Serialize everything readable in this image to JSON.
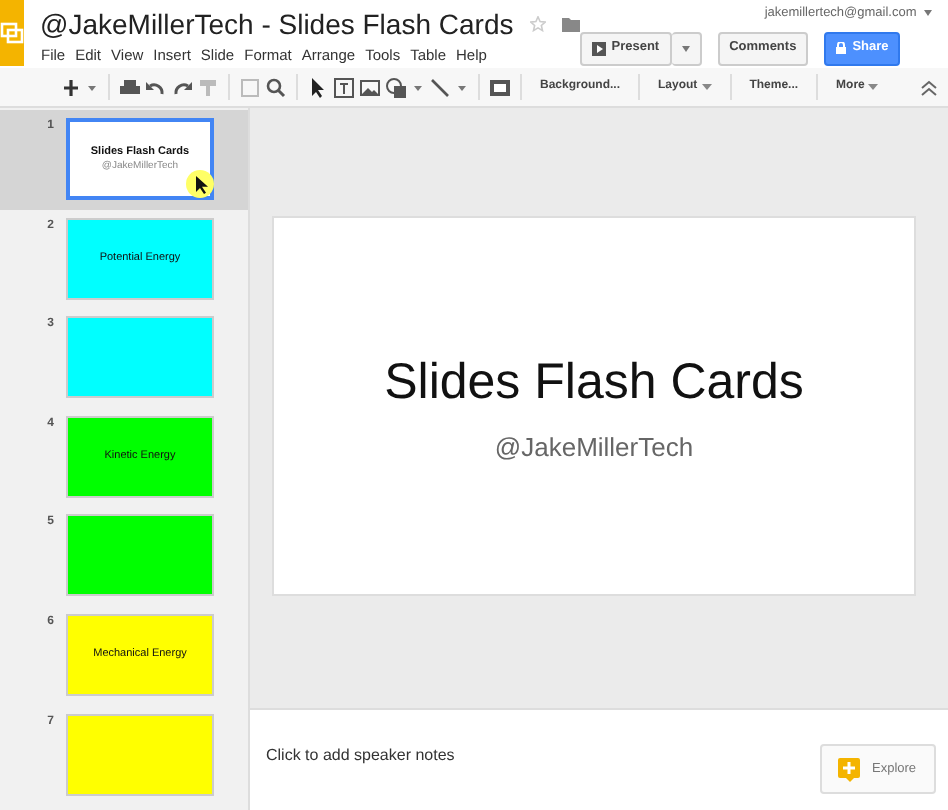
{
  "document": {
    "title": "@JakeMillerTech - Slides Flash Cards",
    "account": "jakemillertech@gmail.com"
  },
  "menus": [
    "File",
    "Edit",
    "View",
    "Insert",
    "Slide",
    "Format",
    "Arrange",
    "Tools",
    "Table",
    "Help"
  ],
  "buttons": {
    "present": "Present",
    "comments": "Comments",
    "share": "Share"
  },
  "toolbar": [
    "Background...",
    "Layout",
    "Theme...",
    "More"
  ],
  "slides": [
    {
      "number": "1",
      "kind": "title",
      "title": "Slides Flash Cards",
      "subtitle": "@JakeMillerTech",
      "color": "#ffffff",
      "selected": true
    },
    {
      "number": "2",
      "kind": "card",
      "label": "Potential Energy",
      "color": "#00ffff",
      "selected": false
    },
    {
      "number": "3",
      "kind": "card",
      "color": "#00ffff",
      "selected": false
    },
    {
      "number": "4",
      "kind": "card",
      "label": "Kinetic Energy",
      "color": "#00ff00",
      "selected": false
    },
    {
      "number": "5",
      "kind": "card",
      "color": "#00ff00",
      "selected": false
    },
    {
      "number": "6",
      "kind": "card",
      "label": "Mechanical Energy",
      "color": "#ffff00",
      "selected": false
    },
    {
      "number": "7",
      "kind": "card",
      "color": "#ffff00",
      "selected": false
    }
  ],
  "current_slide": {
    "title": "Slides Flash Cards",
    "subtitle": "@JakeMillerTech"
  },
  "notes": {
    "placeholder": "Click to add speaker notes"
  },
  "explore": {
    "label": "Explore"
  }
}
